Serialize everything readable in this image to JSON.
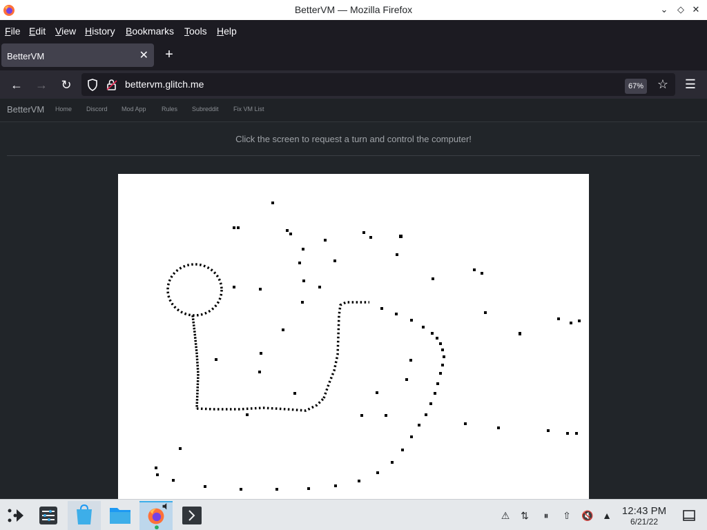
{
  "window": {
    "title": "BetterVM — Mozilla Firefox"
  },
  "menubar": {
    "items": [
      "File",
      "Edit",
      "View",
      "History",
      "Bookmarks",
      "Tools",
      "Help"
    ]
  },
  "tab": {
    "title": "BetterVM"
  },
  "urlbar": {
    "url": "bettervm.glitch.me",
    "zoom": "67%"
  },
  "site": {
    "brand": "BetterVM",
    "nav": [
      "Home",
      "Discord",
      "Mod App",
      "Rules",
      "Subreddit",
      "Fix VM List"
    ],
    "instruction": "Click the screen to request a turn and control the computer!"
  },
  "clock": {
    "time": "12:43 PM",
    "date": "6/21/22"
  },
  "colors": {
    "accent": "#3daee9",
    "browser_bg": "#1c1b22",
    "page_bg": "#212529",
    "vm_bg": "#ffffff"
  }
}
